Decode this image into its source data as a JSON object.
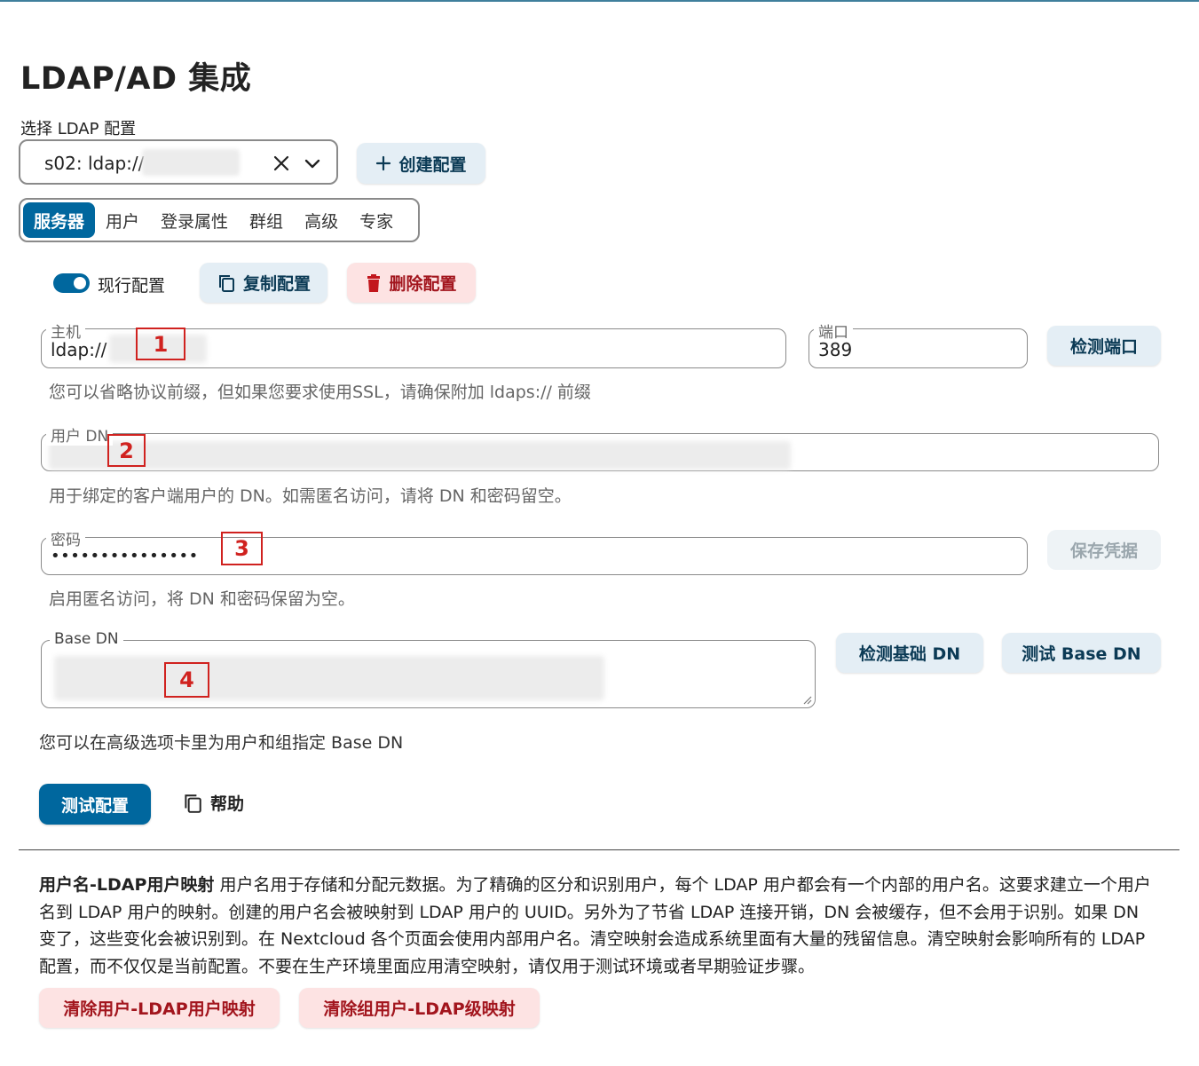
{
  "page": {
    "title": "LDAP/AD 集成",
    "select_label": "选择 LDAP 配置",
    "selected_config": "s02: ldap://",
    "create_config": "创建配置"
  },
  "tabs": [
    {
      "label": "服务器",
      "active": true
    },
    {
      "label": "用户"
    },
    {
      "label": "登录属性"
    },
    {
      "label": "群组"
    },
    {
      "label": "高级"
    },
    {
      "label": "专家"
    }
  ],
  "actions": {
    "active_config_label": "现行配置",
    "active_config_on": true,
    "copy_config": "复制配置",
    "delete_config": "删除配置"
  },
  "server": {
    "host_label": "主机",
    "host_value": "ldap://",
    "port_label": "端口",
    "port_value": "389",
    "detect_port": "检测端口",
    "host_hint": "您可以省略协议前缀，但如果您要求使用SSL，请确保附加 ldaps:// 前缀",
    "user_dn_label": "用户 DN",
    "user_dn_hint": "用于绑定的客户端用户的 DN。如需匿名访问，请将 DN 和密码留空。",
    "password_label": "密码",
    "password_value": "•••••••••••••••",
    "save_credentials": "保存凭据",
    "password_hint": "启用匿名访问，将 DN 和密码保留为空。",
    "base_dn_label": "Base DN",
    "detect_base_dn": "检测基础 DN",
    "test_base_dn": "测试 Base DN",
    "base_dn_hint": "您可以在高级选项卡里为用户和组指定 Base DN"
  },
  "footer_actions": {
    "test_config": "测试配置",
    "help": "帮助"
  },
  "markers": [
    "1",
    "2",
    "3",
    "4"
  ],
  "mapping": {
    "title": "用户名-LDAP用户映射",
    "text": " 用户名用于存储和分配元数据。为了精确的区分和识别用户，每个 LDAP 用户都会有一个内部的用户名。这要求建立一个用户名到 LDAP 用户的映射。创建的用户名会被映射到 LDAP 用户的 UUID。另外为了节省 LDAP 连接开销，DN 会被缓存，但不会用于识别。如果 DN 变了，这些变化会被识别到。在 Nextcloud 各个页面会使用内部用户名。清空映射会造成系统里面有大量的残留信息。清空映射会影响所有的 LDAP 配置，而不仅仅是当前配置。不要在生产环境里面应用清空映射，请仅用于测试环境或者早期验证步骤。",
    "clear_user_mapping": "清除用户-LDAP用户映射",
    "clear_group_mapping": "清除组用户-LDAP级映射"
  },
  "colors": {
    "primary": "#00679e",
    "light_button": "#e4eef5",
    "danger_bg": "#fde3e3",
    "danger_text": "#a2151d",
    "marker": "#d0221f"
  }
}
